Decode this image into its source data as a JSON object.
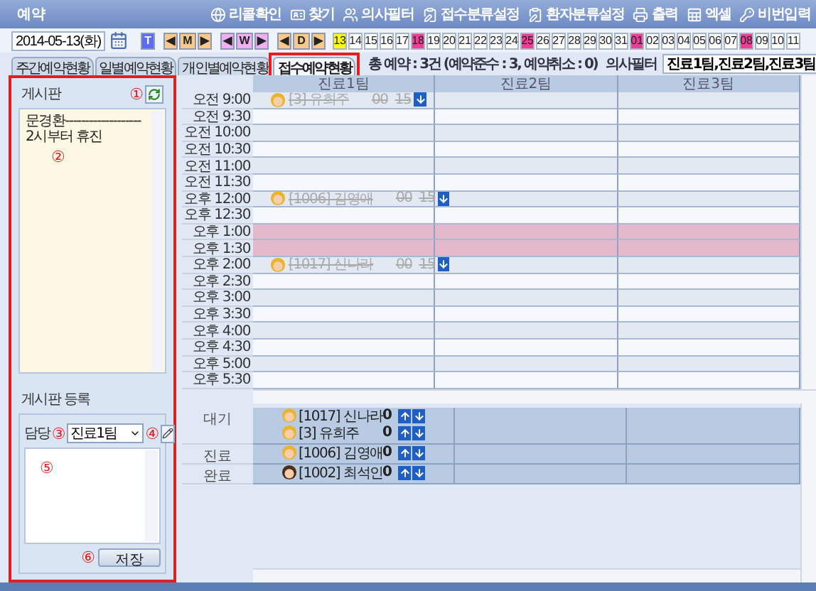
{
  "window": {
    "title": "예약"
  },
  "toolbar": [
    {
      "label": "리콜확인"
    },
    {
      "label": "찾기"
    },
    {
      "label": "의사필터"
    },
    {
      "label": "접수분류설정"
    },
    {
      "label": "환자분류설정"
    },
    {
      "label": "출력"
    },
    {
      "label": "엑셀"
    },
    {
      "label": "비번입력"
    }
  ],
  "date_bar": {
    "date": "2014-05-13(화)",
    "nav": [
      {
        "kind": "today",
        "label": "T",
        "color": "#5b6cf0"
      },
      {
        "kind": "step",
        "prev": "◀",
        "label": "M",
        "next": "▶",
        "color": "#f7c98a"
      },
      {
        "kind": "step",
        "prev": "◀",
        "label": "W",
        "next": "▶",
        "color": "#eeb0f2"
      },
      {
        "kind": "step",
        "prev": "◀",
        "label": "D",
        "next": "▶",
        "color": "#f7c98a"
      }
    ],
    "days": [
      {
        "label": "13",
        "color": "#ffff00"
      },
      {
        "label": "14"
      },
      {
        "label": "15"
      },
      {
        "label": "16"
      },
      {
        "label": "17"
      },
      {
        "label": "18",
        "color": "#ee3e96"
      },
      {
        "label": "19"
      },
      {
        "label": "20"
      },
      {
        "label": "21"
      },
      {
        "label": "22"
      },
      {
        "label": "23"
      },
      {
        "label": "24"
      },
      {
        "label": "25",
        "color": "#ee3e96"
      },
      {
        "label": "26"
      },
      {
        "label": "27"
      },
      {
        "label": "28"
      },
      {
        "label": "29"
      },
      {
        "label": "30"
      },
      {
        "label": "31"
      },
      {
        "label": "01",
        "color": "#ee3e96"
      },
      {
        "label": "02"
      },
      {
        "label": "03"
      },
      {
        "label": "04"
      },
      {
        "label": "05"
      },
      {
        "label": "06"
      },
      {
        "label": "07"
      },
      {
        "label": "08",
        "color": "#ee3e96"
      },
      {
        "label": "09"
      },
      {
        "label": "10"
      },
      {
        "label": "11"
      }
    ]
  },
  "tabs": [
    {
      "label": "주간예약현황",
      "selected": false,
      "highlighted": false
    },
    {
      "label": "일별예약현황",
      "selected": false,
      "highlighted": false
    },
    {
      "label": "개인별예약현황",
      "selected": false,
      "highlighted": false
    },
    {
      "label": "접수예약현황",
      "selected": true,
      "highlighted": true
    }
  ],
  "summary": {
    "text": "총 예약 : 3건 (예약준수 : 3, 예약취소 : 0)",
    "filter_label": "의사필터",
    "filter_value": "진료1팀,진료2팀,진료3팀"
  },
  "board": {
    "highlighted": true,
    "title": "게시판",
    "title_callout": "①",
    "content": "문경환-------------------\n2시부터 휴진",
    "content_callout": "②",
    "register_title": "게시판 등록",
    "assignee_label": "담당",
    "assignee_callout": "③",
    "assignee_value": "진료1팀",
    "edit_callout": "④",
    "message_callout": "⑤",
    "save_callout": "⑥",
    "save_label": "저장"
  },
  "schedule": {
    "columns": [
      "진료1팀",
      "진료2팀",
      "진료3팀"
    ],
    "slots": [
      {
        "time": "오전 9:00",
        "blocked": false,
        "appointment": {
          "kind": "light",
          "name": "[3] 유희주",
          "start": "00",
          "duration": "15",
          "struck": true
        }
      },
      {
        "time": "오전 9:30",
        "blocked": false
      },
      {
        "time": "오전 10:00",
        "blocked": false
      },
      {
        "time": "오전 10:30",
        "blocked": false
      },
      {
        "time": "오전 11:00",
        "blocked": false
      },
      {
        "time": "오전 11:30",
        "blocked": false
      },
      {
        "time": "오후 12:00",
        "blocked": false,
        "appointment": {
          "kind": "light",
          "name": "[1006] 김영애",
          "start": "00",
          "duration": "15",
          "struck": true
        }
      },
      {
        "time": "오후 12:30",
        "blocked": false
      },
      {
        "time": "오후 1:00",
        "blocked": true
      },
      {
        "time": "오후 1:30",
        "blocked": true
      },
      {
        "time": "오후 2:00",
        "blocked": false,
        "appointment": {
          "kind": "light",
          "name": "[1017] 신나라",
          "start": "00",
          "duration": "15",
          "struck": true
        }
      },
      {
        "time": "오후 2:30",
        "blocked": false
      },
      {
        "time": "오후 3:00",
        "blocked": false
      },
      {
        "time": "오후 3:30",
        "blocked": false
      },
      {
        "time": "오후 4:00",
        "blocked": false
      },
      {
        "time": "오후 4:30",
        "blocked": false
      },
      {
        "time": "오후 5:00",
        "blocked": false
      },
      {
        "time": "오후 5:30",
        "blocked": false
      }
    ]
  },
  "status": [
    {
      "label": "대기",
      "patients": [
        {
          "kind": "light",
          "name": "[1017] 신나라",
          "count": "0"
        },
        {
          "kind": "light",
          "name": "[3] 유희주",
          "count": "0"
        }
      ]
    },
    {
      "label": "진료",
      "patients": [
        {
          "kind": "light",
          "name": "[1006] 김영애",
          "count": "0"
        }
      ]
    },
    {
      "label": "완료",
      "patients": [
        {
          "kind": "dark",
          "name": "[1002] 최석인",
          "count": "0"
        }
      ]
    }
  ]
}
